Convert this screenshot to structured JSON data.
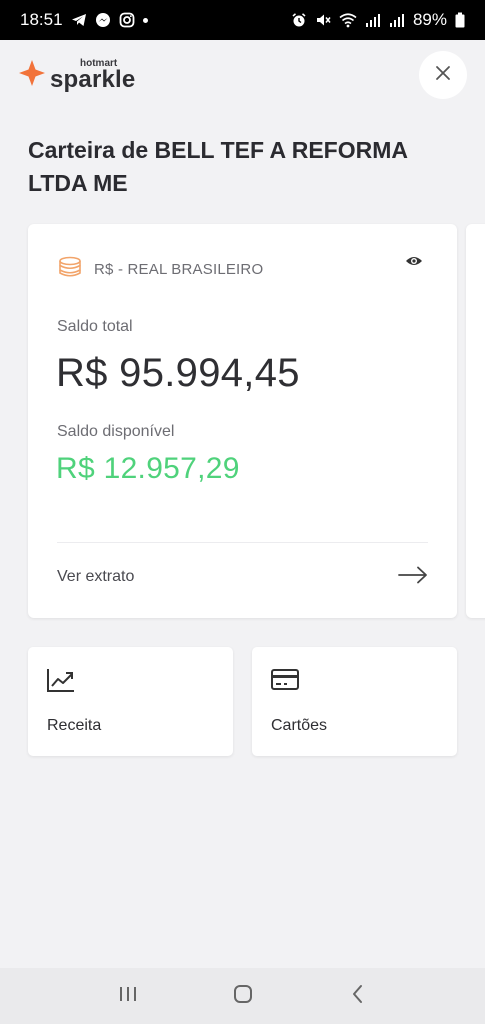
{
  "status_bar": {
    "time": "18:51",
    "left_icons": [
      "telegram-icon",
      "messenger-icon",
      "instagram-icon",
      "dot-icon"
    ],
    "right_icons": [
      "alarm-icon",
      "mute-icon",
      "wifi-icon",
      "signal-icon",
      "signal-icon"
    ],
    "battery": "89%"
  },
  "header": {
    "brand_small": "hotmart",
    "brand_name": "sparkle",
    "brand_color": "#f2733a",
    "close_icon": "close-icon"
  },
  "wallet": {
    "title": "Carteira de BELL TEF A REFORMA LTDA ME"
  },
  "balance_card": {
    "currency_icon": "coins-icon",
    "currency": "R$ - REAL BRASILEIRO",
    "visibility_icon": "eye-icon",
    "total_label": "Saldo total",
    "total_value": "R$ 95.994,45",
    "available_label": "Saldo disponível",
    "available_value": "R$ 12.957,29",
    "available_color": "#4fd27b",
    "statement_label": "Ver extrato",
    "statement_icon": "arrow-right-icon"
  },
  "actions": [
    {
      "icon": "trending-up-icon",
      "label": "Receita"
    },
    {
      "icon": "credit-card-icon",
      "label": "Cartões"
    }
  ],
  "nav_bar": {
    "buttons": [
      "recent-apps-icon",
      "home-icon",
      "back-icon"
    ]
  }
}
